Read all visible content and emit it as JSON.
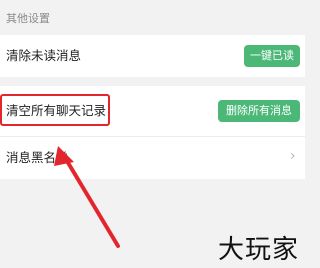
{
  "section": {
    "title": "其他设置"
  },
  "rows": [
    {
      "label": "清除未读消息",
      "button": "一键已读"
    },
    {
      "label": "清空所有聊天记录",
      "button": "删除所有消息"
    },
    {
      "label": "消息黑名单"
    }
  ],
  "watermark": "大玩家",
  "colors": {
    "accent_green": "#4cb878",
    "annotation_red": "#e3262d"
  },
  "icons": {
    "row3": "chevron-right-icon"
  }
}
